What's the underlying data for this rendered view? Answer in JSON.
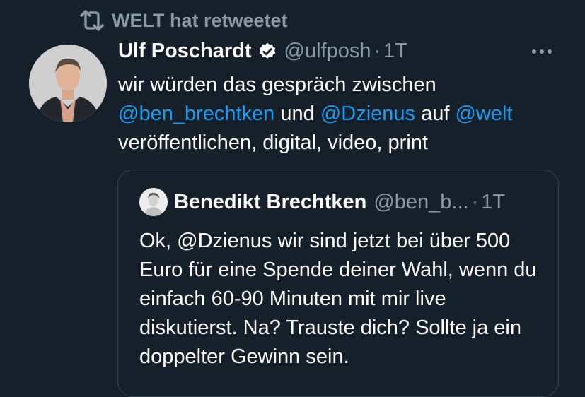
{
  "retweet": {
    "label": "WELT hat retweetet"
  },
  "tweet": {
    "author_name": "Ulf Poschardt",
    "handle": "@ulfposh",
    "separator": "·",
    "time": "1T",
    "text_1": "wir würden das gespräch zwischen",
    "mention_1": "@ben_brechtken",
    "text_2": " und ",
    "mention_2": "@Dzienus",
    "text_3": " auf ",
    "mention_3": "@welt",
    "text_4": "veröffentlichen, digital, video, print"
  },
  "quote": {
    "author_name": "Benedikt Brechtken",
    "handle": "@ben_b...",
    "separator": "·",
    "time": "1T",
    "text": "Ok, @Dzienus wir sind jetzt bei über 500 Euro für eine Spende deiner Wahl, wenn du einfach 60-90 Minuten mit mir live diskutierst. Na? Trauste dich? Sollte ja ein doppelter Gewinn sein."
  },
  "colors": {
    "background": "#15202b",
    "accent": "#1d9bf0",
    "muted": "#8b98a5",
    "border": "#38444d"
  },
  "icons": [
    "retweet-icon",
    "verified-badge-icon",
    "more-options-icon"
  ]
}
